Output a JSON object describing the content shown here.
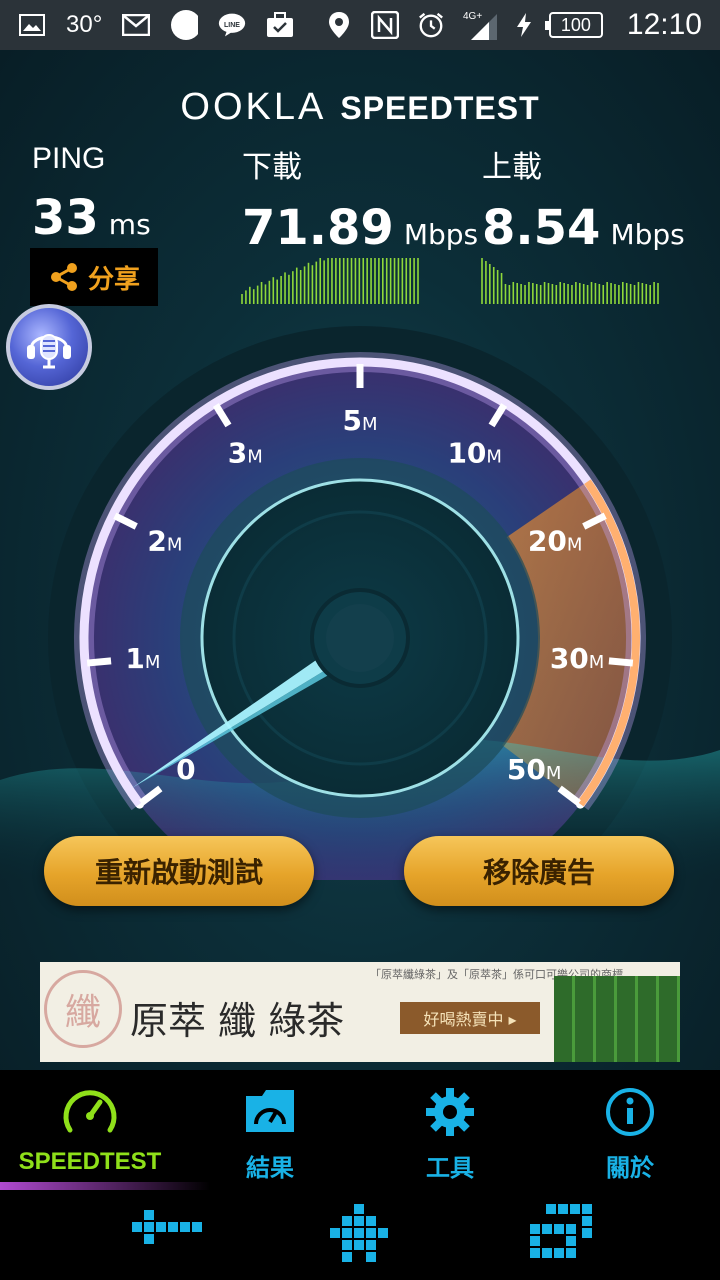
{
  "status_bar": {
    "temperature": "30°",
    "network": "4G+",
    "battery": "100",
    "time": "12:10"
  },
  "header": {
    "logo_ookla": "OOKLA",
    "logo_speedtest": "SPEEDTEST"
  },
  "stats": {
    "ping_label": "PING",
    "ping_value": "33",
    "ping_unit": "ms",
    "download_label": "下載",
    "download_value": "71.89",
    "download_unit": "Mbps",
    "upload_label": "上載",
    "upload_value": "8.54",
    "upload_unit": "Mbps"
  },
  "share_label": "分享",
  "gauge": {
    "ticks": [
      {
        "num": "0",
        "unit": ""
      },
      {
        "num": "1",
        "unit": "M"
      },
      {
        "num": "2",
        "unit": "M"
      },
      {
        "num": "3",
        "unit": "M"
      },
      {
        "num": "5",
        "unit": "M"
      },
      {
        "num": "10",
        "unit": "M"
      },
      {
        "num": "20",
        "unit": "M"
      },
      {
        "num": "30",
        "unit": "M"
      },
      {
        "num": "50",
        "unit": "M"
      }
    ],
    "colors": {
      "arc": "#c9b8ff",
      "fill": "#e8843a",
      "needle": "#a9f3ff"
    }
  },
  "buttons": {
    "restart": "重新啟動測試",
    "remove_ads": "移除廣告"
  },
  "ad": {
    "stamp": "纖",
    "brand": "原萃 纖 綠茶",
    "small": "「原萃纖綠茶」及「原萃茶」係可口可樂公司的商標",
    "cta": "好喝熱賣中 ▸"
  },
  "nav": {
    "items": [
      {
        "label": "SPEEDTEST",
        "icon": "speedometer-icon"
      },
      {
        "label": "結果",
        "icon": "results-folder-icon"
      },
      {
        "label": "工具",
        "icon": "gear-icon"
      },
      {
        "label": "關於",
        "icon": "info-icon"
      }
    ]
  }
}
